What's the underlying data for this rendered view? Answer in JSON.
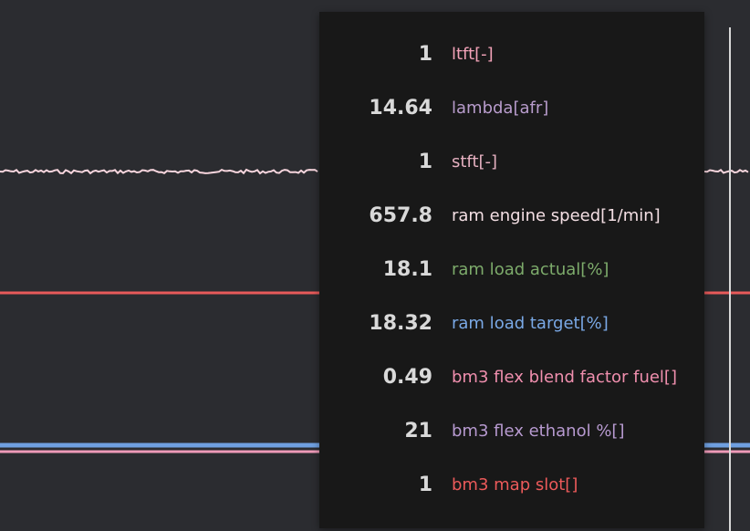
{
  "colors": {
    "background": "#2b2c30",
    "tooltip_bg": "#181818",
    "value_text": "#d9d9d9",
    "cursor": "#d8d8d8"
  },
  "tooltip": {
    "rows": [
      {
        "value": "1",
        "label": "ltft[-]",
        "color": "#f2a2b8"
      },
      {
        "value": "14.64",
        "label": "lambda[afr]",
        "color": "#b89ccc"
      },
      {
        "value": "1",
        "label": "stft[-]",
        "color": "#e5b0c0"
      },
      {
        "value": "657.8",
        "label": "ram engine speed[1/min]",
        "color": "#f4dfe4"
      },
      {
        "value": "18.1",
        "label": "ram load actual[%]",
        "color": "#7dab6b"
      },
      {
        "value": "18.32",
        "label": "ram load target[%]",
        "color": "#7aa9e6"
      },
      {
        "value": "0.49",
        "label": "bm3 flex blend factor fuel[]",
        "color": "#f08fae"
      },
      {
        "value": "21",
        "label": "bm3 flex ethanol %[]",
        "color": "#b79ad0"
      },
      {
        "value": "1",
        "label": "bm3 map slot[]",
        "color": "#ec5a5a"
      }
    ]
  },
  "traces": {
    "engine_speed_color": "#f8d6de",
    "red_line_color": "#e85a5a",
    "blue_line_color": "#6f9fe0",
    "pink_line_color": "#ee9ab8"
  }
}
